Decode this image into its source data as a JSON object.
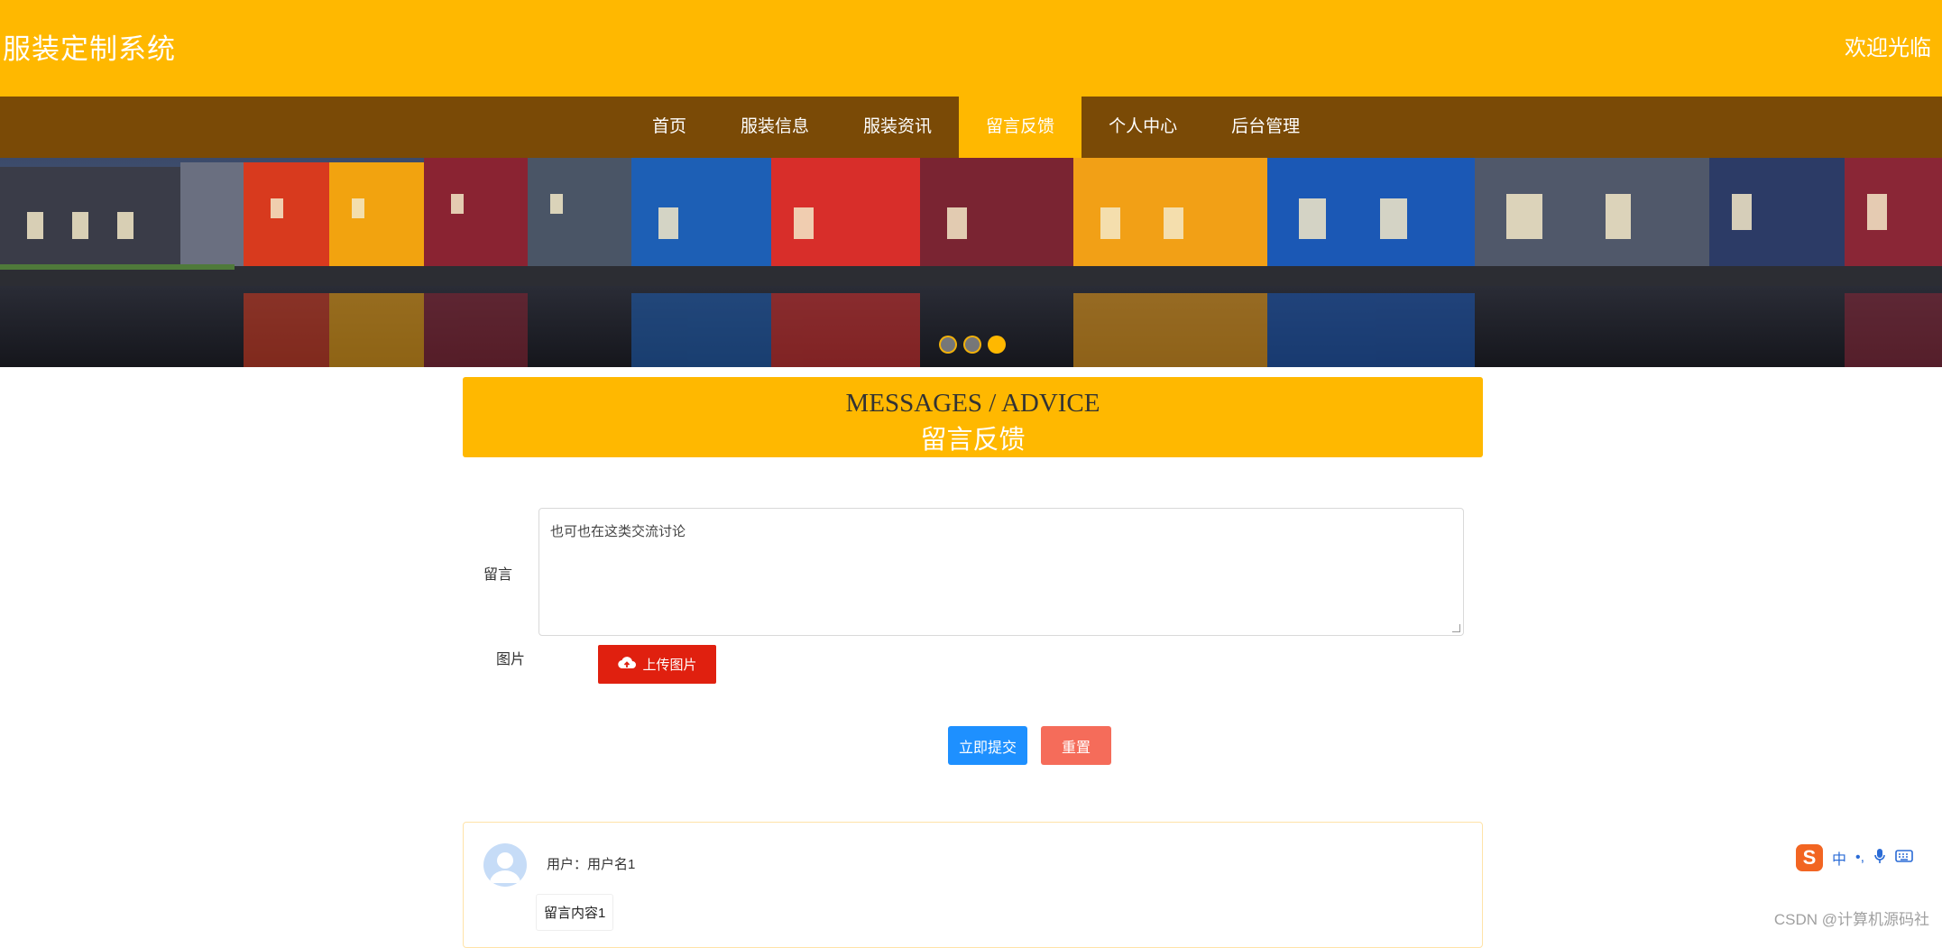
{
  "header": {
    "site_title": "服装定制系统",
    "welcome_text": "欢迎光临",
    "brand_color": "#ffb800"
  },
  "nav": {
    "items": [
      {
        "label": "首页",
        "active": false
      },
      {
        "label": "服装信息",
        "active": false
      },
      {
        "label": "服装资讯",
        "active": false
      },
      {
        "label": "留言反馈",
        "active": true
      },
      {
        "label": "个人中心",
        "active": false
      },
      {
        "label": "后台管理",
        "active": false
      }
    ],
    "background_color": "#7a4a06"
  },
  "banner": {
    "slide_count": 3,
    "active_slide": 3
  },
  "section": {
    "title_en": "MESSAGES / ADVICE",
    "title_cn": "留言反馈"
  },
  "form": {
    "message_label": "留言",
    "message_value": "也可也在这类交流讨论",
    "image_label": "图片",
    "upload_label": "上传图片",
    "submit_label": "立即提交",
    "reset_label": "重置"
  },
  "messages": [
    {
      "user_text": "用户：用户名1",
      "content": "留言内容1"
    }
  ],
  "ime_toolbar": {
    "logo": "S",
    "items": [
      "中",
      "•,",
      "mic-icon",
      "keyboard-icon"
    ]
  },
  "watermark": "CSDN @计算机源码社"
}
